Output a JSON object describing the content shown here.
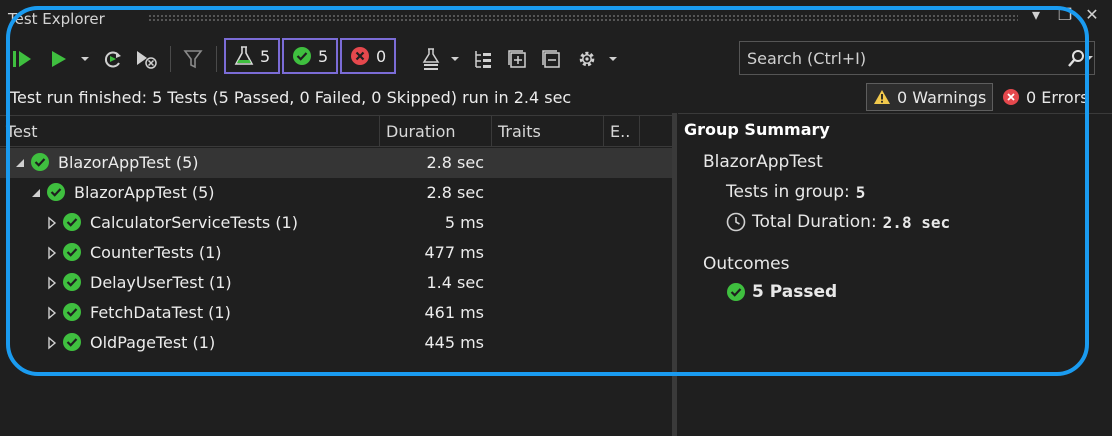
{
  "window": {
    "title": "Test Explorer",
    "restore_glyph": "❐",
    "close_glyph": "✕",
    "dropdown_glyph": "▾"
  },
  "toolbar": {
    "counters": [
      {
        "icon": "flask-icon",
        "value": "5"
      },
      {
        "icon": "passed-icon",
        "value": "5"
      },
      {
        "icon": "failed-icon",
        "value": "0"
      }
    ],
    "search_placeholder": "Search (Ctrl+I)"
  },
  "status": {
    "message": "Test run finished: 5 Tests (5 Passed, 0 Failed, 0 Skipped) run in 2.4 sec",
    "warnings_label": "0 Warnings",
    "errors_label": "0 Errors"
  },
  "grid": {
    "columns": [
      "Test",
      "Duration",
      "Traits",
      "E.."
    ],
    "rows": [
      {
        "name": "BlazorAppTest (5)",
        "duration": "2.8 sec",
        "expanded": true
      },
      {
        "name": "BlazorAppTest (5)",
        "duration": "2.8 sec",
        "expanded": true
      },
      {
        "name": "CalculatorServiceTests (1)",
        "duration": "5 ms",
        "expanded": false
      },
      {
        "name": "CounterTests (1)",
        "duration": "477 ms",
        "expanded": false
      },
      {
        "name": "DelayUserTest (1)",
        "duration": "1.4 sec",
        "expanded": false
      },
      {
        "name": "FetchDataTest (1)",
        "duration": "461 ms",
        "expanded": false
      },
      {
        "name": "OldPageTest (1)",
        "duration": "445 ms",
        "expanded": false
      }
    ]
  },
  "summary": {
    "heading": "Group Summary",
    "group_name": "BlazorAppTest",
    "tests_in_group_label": "Tests in group:",
    "tests_in_group_value": "5",
    "total_duration_label": "Total Duration:",
    "total_duration_value": "2.8 sec",
    "outcomes_label": "Outcomes",
    "passed_label": "5 Passed"
  },
  "colors": {
    "accent_highlight": "#1a9bf0",
    "passed": "#3fbf3f",
    "failed": "#e5484d",
    "counter_border": "#7b6cd6"
  }
}
